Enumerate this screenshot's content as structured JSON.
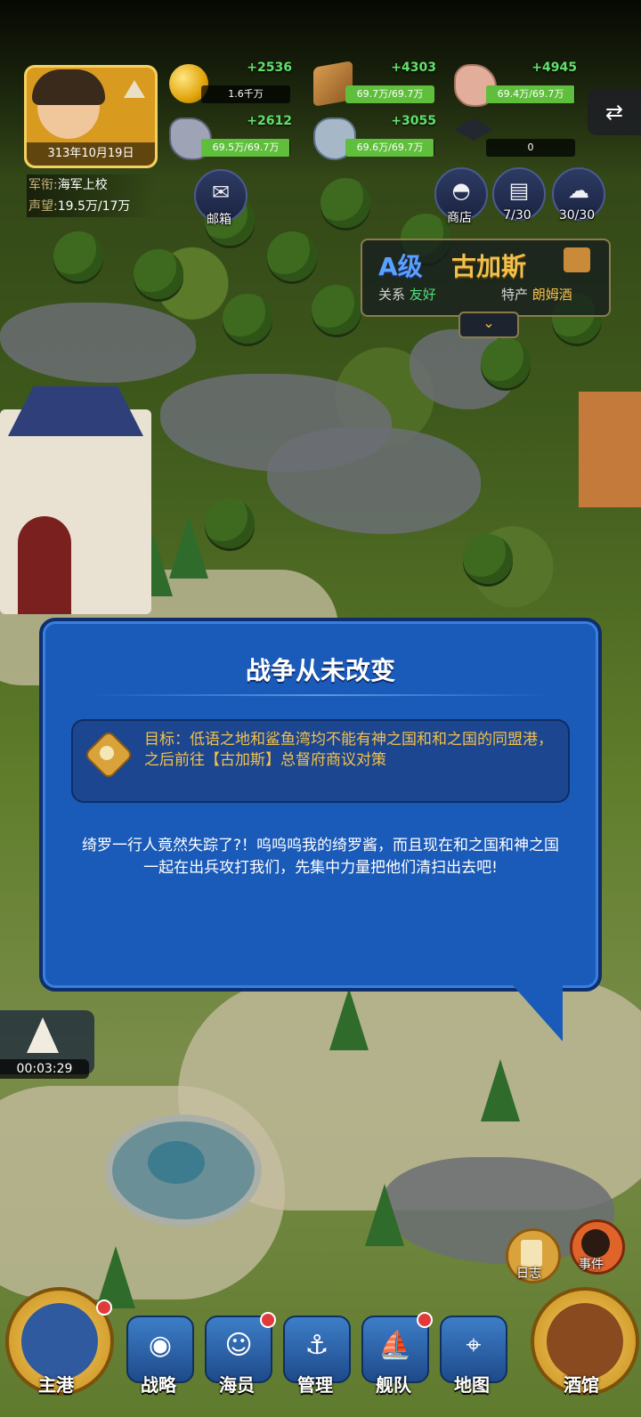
{
  "player": {
    "date": "313年10月19日",
    "rank_key": "军衔:",
    "rank_value": "海军上校",
    "fame_key": "声望:",
    "fame_value": "19.5万/17万"
  },
  "resources": [
    {
      "icon": "gold-coin-icon",
      "gain": "+2536",
      "value": "1.6千万",
      "fill": 0
    },
    {
      "icon": "wood-icon",
      "gain": "+4303",
      "value": "69.7万/69.7万",
      "fill": 1.0
    },
    {
      "icon": "meat-icon",
      "gain": "+4945",
      "value": "69.4万/69.7万",
      "fill": 0.99
    },
    {
      "icon": "stone-icon",
      "gain": "+2612",
      "value": "69.5万/69.7万",
      "fill": 0.99
    },
    {
      "icon": "ore-icon",
      "gain": "+3055",
      "value": "69.6万/69.7万",
      "fill": 0.99
    },
    {
      "icon": "graduation-cap-icon",
      "gain": "",
      "value": "0",
      "fill": 0
    }
  ],
  "top_buttons": {
    "mail": "邮箱",
    "shop": "商店",
    "books": "7/30",
    "chat": "30/30"
  },
  "city": {
    "grade": "A级",
    "name": "古加斯",
    "relation_key": "关系",
    "relation_value": "友好",
    "specialty_key": "特产",
    "specialty_value": "朗姆酒"
  },
  "dialog": {
    "title": "战争从未改变",
    "goal": "目标：低语之地和鲨鱼湾均不能有神之国和和之国的同盟港，之后前往【古加斯】总督府商议对策",
    "story": "绮罗一行人竟然失踪了?！呜呜呜我的绮罗酱，而且现在和之国和神之国一起在出兵攻打我们，先集中力量把他们清扫出去吧!"
  },
  "timer": "00:03:29",
  "side": {
    "log": "日志",
    "event": "事件"
  },
  "bottom_nav": {
    "home_port": "主港",
    "strategy": "战略",
    "crew": "海员",
    "manage": "管理",
    "fleet": "舰队",
    "map": "地图",
    "tavern": "酒馆"
  },
  "colors": {
    "dialog_bg": "#1a5ab8",
    "goal_text": "#f2c04b",
    "gain_text": "#61e06d",
    "city_grade": "#5aa0ff"
  }
}
